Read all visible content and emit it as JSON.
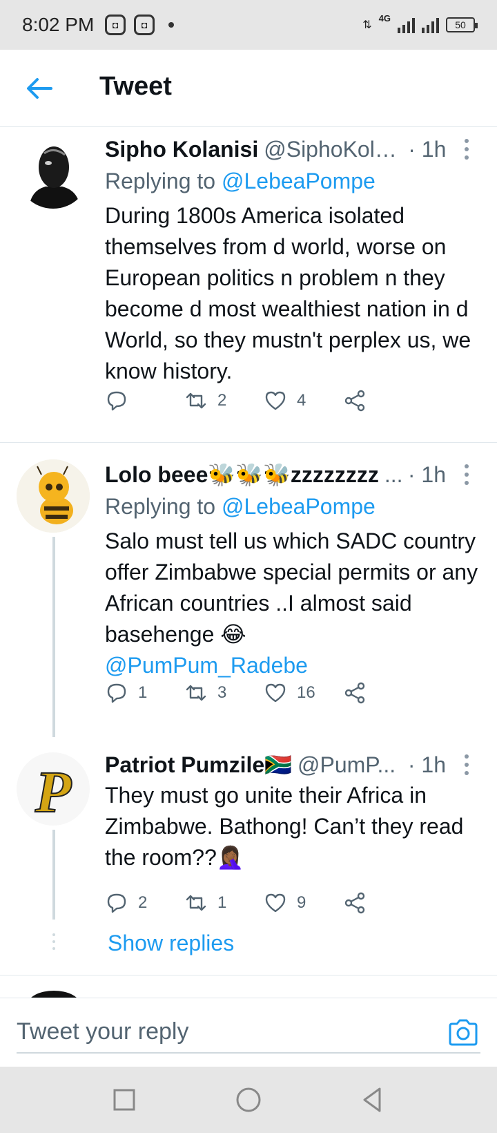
{
  "status_bar": {
    "time": "8:02 PM",
    "network": "4G",
    "battery": "50"
  },
  "header": {
    "title": "Tweet"
  },
  "tweets": [
    {
      "name": "Sipho Kolanisi",
      "handle": "@SiphoKola...",
      "time": "· 1h",
      "replying_prefix": "Replying to",
      "replying_to": "@LebeaPompe",
      "text": "During 1800s America isolated themselves from d world, worse on European politics n problem n they become d most wealthiest nation in d World, so they mustn't perplex us, we know history.",
      "replies": "",
      "retweets": "2",
      "likes": "4"
    },
    {
      "name": "Lolo beee🐝🐝🐝zzzzzzzz",
      "handle": "...",
      "time": "· 1h",
      "replying_prefix": "Replying to",
      "replying_to": "@LebeaPompe",
      "text": "Salo must tell us which SADC country offer Zimbabwe special permits or any African countries ..I almost said basehenge 😂",
      "text_link": "@PumPum_Radebe",
      "replies": "1",
      "retweets": "3",
      "likes": "16"
    },
    {
      "name": "Patriot Pumzile🇿🇦",
      "handle": "@PumP...",
      "time": "· 1h",
      "text": "They must go unite their Africa in Zimbabwe. Bathong! Can’t they read the room??🤦🏾‍♀️",
      "replies": "2",
      "retweets": "1",
      "likes": "9"
    }
  ],
  "show_replies": "Show replies",
  "composer": {
    "placeholder": "Tweet your reply"
  },
  "colors": {
    "accent": "#1d9bf0",
    "muted": "#536471",
    "divider": "#e1e8ed"
  }
}
